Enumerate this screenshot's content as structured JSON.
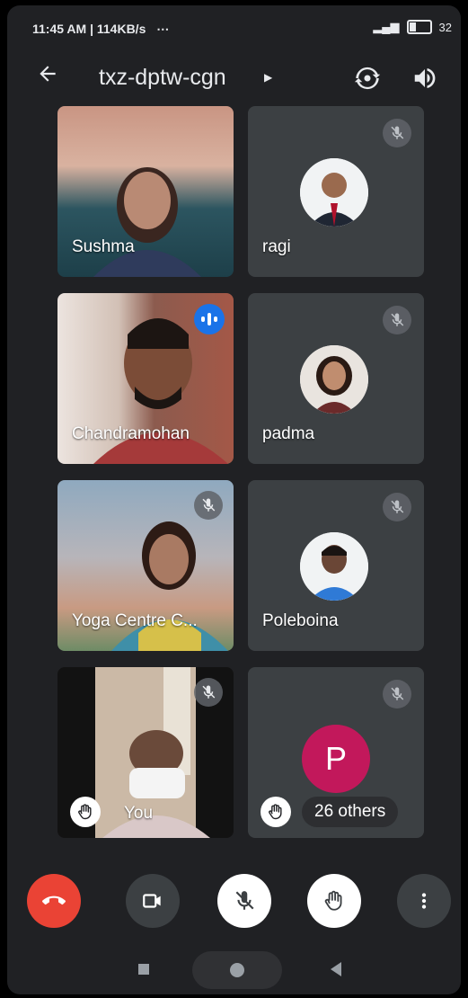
{
  "status_bar": {
    "time_and_speed": "11:45 AM | 114KB/s",
    "extras": "⋯",
    "battery": "32"
  },
  "header": {
    "meeting_code": "txz-dptw-cgn",
    "back_icon": "back-arrow-icon",
    "switch_camera_icon": "switch-camera-icon",
    "speaker_icon": "speaker-icon"
  },
  "participants": [
    {
      "name": "Sushma",
      "video": true,
      "muted": false
    },
    {
      "name": "ragi",
      "video": false,
      "muted": true
    },
    {
      "name": "Chandramohan",
      "video": true,
      "speaking": true
    },
    {
      "name": "padma",
      "video": false,
      "muted": true
    },
    {
      "name": "Yoga Centre C...",
      "video": true,
      "muted": true
    },
    {
      "name": "Poleboina",
      "video": false,
      "muted": true
    },
    {
      "name": "You",
      "video": true,
      "muted": true,
      "hand_raised": true
    },
    {
      "name": "26 others",
      "letter": "P",
      "muted": true,
      "hand_raised": true
    }
  ],
  "controls": {
    "end_call_icon": "end-call-icon",
    "camera_icon": "camera-icon",
    "mic_off_icon": "mic-off-icon",
    "raise_hand_icon": "raise-hand-icon",
    "more_icon": "more-vert-icon"
  },
  "colors": {
    "background": "#202124",
    "tile": "#3c4043",
    "end_call": "#ea4335",
    "speaking": "#1a73e8",
    "letter_avatar": "#c2185b"
  }
}
